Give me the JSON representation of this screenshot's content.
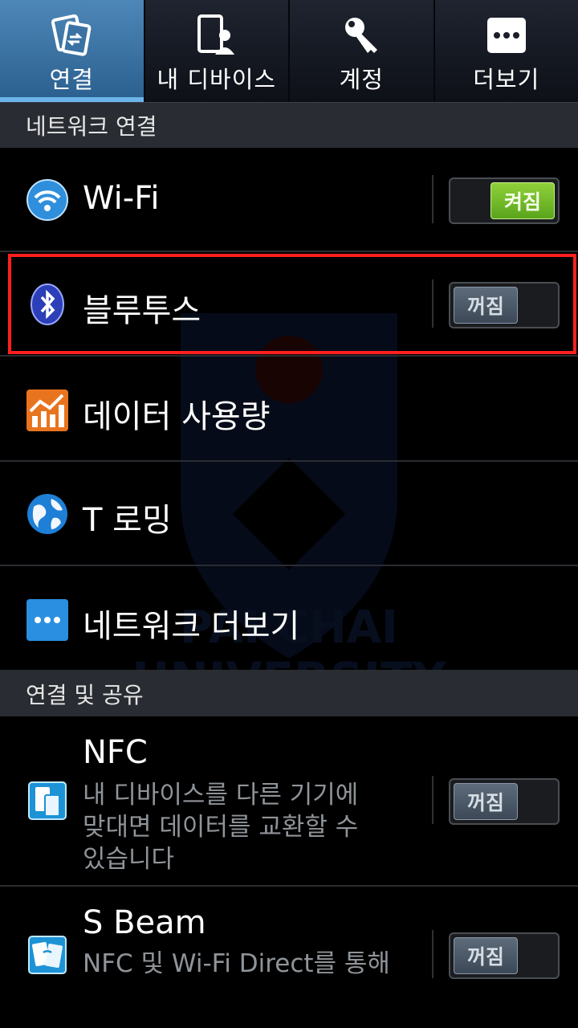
{
  "tabs": [
    {
      "label": "연결",
      "icon": "connect-icon",
      "active": true
    },
    {
      "label": "내 디바이스",
      "icon": "my-device-icon",
      "active": false
    },
    {
      "label": "계정",
      "icon": "account-key-icon",
      "active": false
    },
    {
      "label": "더보기",
      "icon": "more-icon",
      "active": false
    }
  ],
  "sections": {
    "network": "네트워크 연결",
    "sharing": "연결 및 공유"
  },
  "rows": {
    "wifi": {
      "label": "Wi-Fi",
      "toggle": "켜짐"
    },
    "bluetooth": {
      "label": "블루투스",
      "toggle": "꺼짐"
    },
    "data_usage": {
      "label": "데이터 사용량"
    },
    "roaming": {
      "label": "T 로밍"
    },
    "network_more": {
      "label": "네트워크 더보기"
    },
    "nfc": {
      "label": "NFC",
      "desc1": "내 디바이스를 다른 기기에",
      "desc2": "맞대면 데이터를 교환할 수",
      "desc3": "있습니다",
      "toggle": "꺼짐"
    },
    "sbeam": {
      "label": "S Beam",
      "desc1": "NFC 및 Wi-Fi Direct를 통해",
      "toggle": "꺼짐"
    }
  },
  "watermark_text": {
    "line1": "PAI CHAI",
    "line2": "UNIVERSITY"
  },
  "colors": {
    "active_tab": "#3f78a8",
    "toggle_on": "#6cbd27",
    "highlight": "#ff1f1f"
  }
}
